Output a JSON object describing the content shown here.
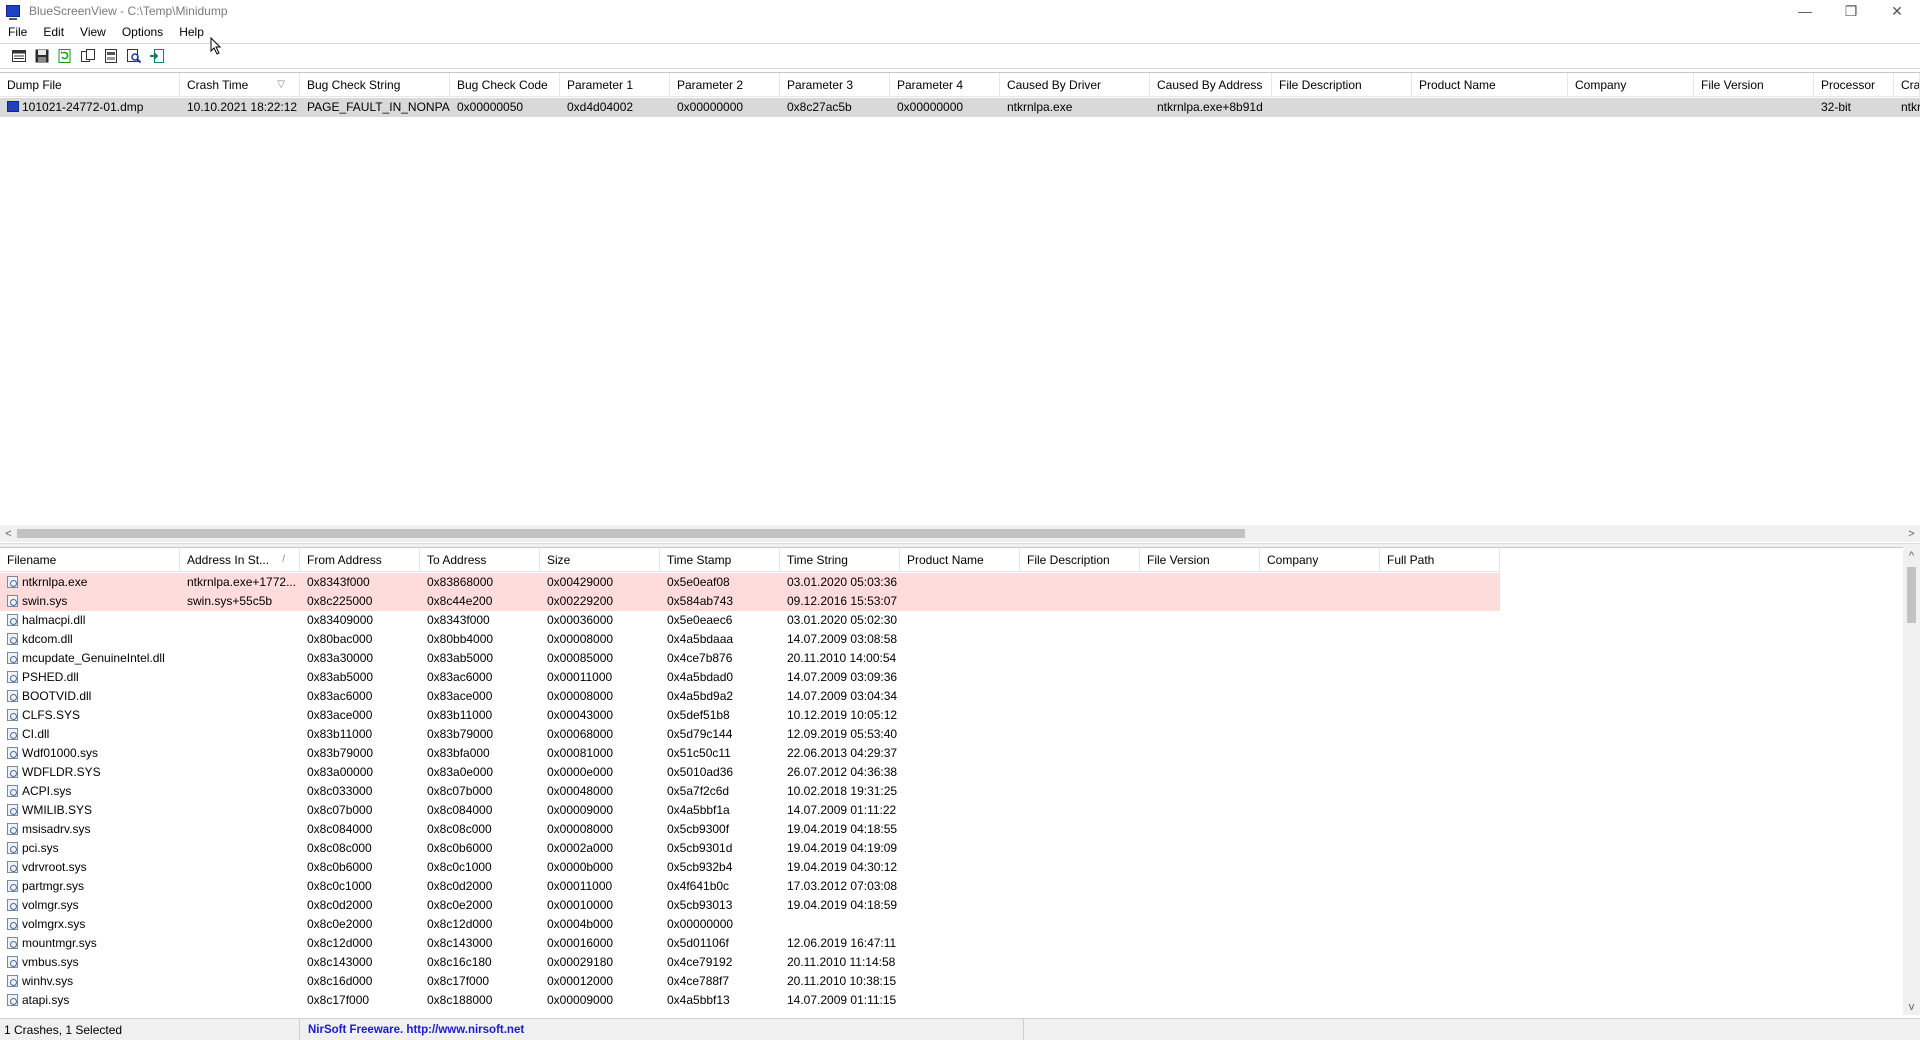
{
  "window": {
    "title": "BlueScreenView  -  C:\\Temp\\Minidump",
    "minimize": "—",
    "restore": "❐",
    "close": "✕"
  },
  "menu": [
    "File",
    "Edit",
    "View",
    "Options",
    "Help"
  ],
  "toolbar": {
    "buttons": [
      "properties-icon",
      "save-icon",
      "refresh-icon",
      "copy-icon",
      "html-report-icon",
      "find-icon",
      "exit-icon"
    ]
  },
  "crash_list": {
    "columns": [
      "Dump File",
      "Crash Time",
      "Bug Check String",
      "Bug Check Code",
      "Parameter 1",
      "Parameter 2",
      "Parameter 3",
      "Parameter 4",
      "Caused By Driver",
      "Caused By Address",
      "File Description",
      "Product Name",
      "Company",
      "File Version",
      "Processor",
      "Crash Add"
    ],
    "sort_indicator": "▽",
    "rows": [
      {
        "dump_file": "101021-24772-01.dmp",
        "crash_time": "10.10.2021 18:22:12",
        "bug_check_string": "PAGE_FAULT_IN_NONPA...",
        "bug_check_code": "0x00000050",
        "parameter_1": "0xd4d04002",
        "parameter_2": "0x00000000",
        "parameter_3": "0x8c27ac5b",
        "parameter_4": "0x00000000",
        "caused_by_driver": "ntkrnlpa.exe",
        "caused_by_address": "ntkrnlpa.exe+8b91d",
        "file_description": "",
        "product_name": "",
        "company": "",
        "file_version": "",
        "processor": "32-bit",
        "crash_address": "ntkrnlpa.e"
      }
    ]
  },
  "scroll": {
    "left_arrow": "<",
    "right_arrow": ">",
    "up_arrow": "^",
    "down_arrow": "v"
  },
  "module_list": {
    "columns": [
      "Filename",
      "Address In St...",
      "From Address",
      "To Address",
      "Size",
      "Time Stamp",
      "Time String",
      "Product Name",
      "File Description",
      "File Version",
      "Company",
      "Full Path"
    ],
    "sort_indicator": "/",
    "rows": [
      {
        "filename": "ntkrnlpa.exe",
        "address_in_stack": "ntkrnlpa.exe+1772...",
        "from": "0x8343f000",
        "to": "0x83868000",
        "size": "0x00429000",
        "stamp": "0x5e0eaf08",
        "time": "03.01.2020 05:03:36",
        "highlight": true
      },
      {
        "filename": "swin.sys",
        "address_in_stack": "swin.sys+55c5b",
        "from": "0x8c225000",
        "to": "0x8c44e200",
        "size": "0x00229200",
        "stamp": "0x584ab743",
        "time": "09.12.2016 15:53:07",
        "highlight": true
      },
      {
        "filename": "halmacpi.dll",
        "address_in_stack": "",
        "from": "0x83409000",
        "to": "0x8343f000",
        "size": "0x00036000",
        "stamp": "0x5e0eaec6",
        "time": "03.01.2020 05:02:30",
        "highlight": false
      },
      {
        "filename": "kdcom.dll",
        "address_in_stack": "",
        "from": "0x80bac000",
        "to": "0x80bb4000",
        "size": "0x00008000",
        "stamp": "0x4a5bdaaa",
        "time": "14.07.2009 03:08:58",
        "highlight": false
      },
      {
        "filename": "mcupdate_GenuineIntel.dll",
        "address_in_stack": "",
        "from": "0x83a30000",
        "to": "0x83ab5000",
        "size": "0x00085000",
        "stamp": "0x4ce7b876",
        "time": "20.11.2010 14:00:54",
        "highlight": false
      },
      {
        "filename": "PSHED.dll",
        "address_in_stack": "",
        "from": "0x83ab5000",
        "to": "0x83ac6000",
        "size": "0x00011000",
        "stamp": "0x4a5bdad0",
        "time": "14.07.2009 03:09:36",
        "highlight": false
      },
      {
        "filename": "BOOTVID.dll",
        "address_in_stack": "",
        "from": "0x83ac6000",
        "to": "0x83ace000",
        "size": "0x00008000",
        "stamp": "0x4a5bd9a2",
        "time": "14.07.2009 03:04:34",
        "highlight": false
      },
      {
        "filename": "CLFS.SYS",
        "address_in_stack": "",
        "from": "0x83ace000",
        "to": "0x83b11000",
        "size": "0x00043000",
        "stamp": "0x5def51b8",
        "time": "10.12.2019 10:05:12",
        "highlight": false
      },
      {
        "filename": "CI.dll",
        "address_in_stack": "",
        "from": "0x83b11000",
        "to": "0x83b79000",
        "size": "0x00068000",
        "stamp": "0x5d79c144",
        "time": "12.09.2019 05:53:40",
        "highlight": false
      },
      {
        "filename": "Wdf01000.sys",
        "address_in_stack": "",
        "from": "0x83b79000",
        "to": "0x83bfa000",
        "size": "0x00081000",
        "stamp": "0x51c50c11",
        "time": "22.06.2013 04:29:37",
        "highlight": false
      },
      {
        "filename": "WDFLDR.SYS",
        "address_in_stack": "",
        "from": "0x83a00000",
        "to": "0x83a0e000",
        "size": "0x0000e000",
        "stamp": "0x5010ad36",
        "time": "26.07.2012 04:36:38",
        "highlight": false
      },
      {
        "filename": "ACPI.sys",
        "address_in_stack": "",
        "from": "0x8c033000",
        "to": "0x8c07b000",
        "size": "0x00048000",
        "stamp": "0x5a7f2c6d",
        "time": "10.02.2018 19:31:25",
        "highlight": false
      },
      {
        "filename": "WMILIB.SYS",
        "address_in_stack": "",
        "from": "0x8c07b000",
        "to": "0x8c084000",
        "size": "0x00009000",
        "stamp": "0x4a5bbf1a",
        "time": "14.07.2009 01:11:22",
        "highlight": false
      },
      {
        "filename": "msisadrv.sys",
        "address_in_stack": "",
        "from": "0x8c084000",
        "to": "0x8c08c000",
        "size": "0x00008000",
        "stamp": "0x5cb9300f",
        "time": "19.04.2019 04:18:55",
        "highlight": false
      },
      {
        "filename": "pci.sys",
        "address_in_stack": "",
        "from": "0x8c08c000",
        "to": "0x8c0b6000",
        "size": "0x0002a000",
        "stamp": "0x5cb9301d",
        "time": "19.04.2019 04:19:09",
        "highlight": false
      },
      {
        "filename": "vdrvroot.sys",
        "address_in_stack": "",
        "from": "0x8c0b6000",
        "to": "0x8c0c1000",
        "size": "0x0000b000",
        "stamp": "0x5cb932b4",
        "time": "19.04.2019 04:30:12",
        "highlight": false
      },
      {
        "filename": "partmgr.sys",
        "address_in_stack": "",
        "from": "0x8c0c1000",
        "to": "0x8c0d2000",
        "size": "0x00011000",
        "stamp": "0x4f641b0c",
        "time": "17.03.2012 07:03:08",
        "highlight": false
      },
      {
        "filename": "volmgr.sys",
        "address_in_stack": "",
        "from": "0x8c0d2000",
        "to": "0x8c0e2000",
        "size": "0x00010000",
        "stamp": "0x5cb93013",
        "time": "19.04.2019 04:18:59",
        "highlight": false
      },
      {
        "filename": "volmgrx.sys",
        "address_in_stack": "",
        "from": "0x8c0e2000",
        "to": "0x8c12d000",
        "size": "0x0004b000",
        "stamp": "0x00000000",
        "time": "",
        "highlight": false
      },
      {
        "filename": "mountmgr.sys",
        "address_in_stack": "",
        "from": "0x8c12d000",
        "to": "0x8c143000",
        "size": "0x00016000",
        "stamp": "0x5d01106f",
        "time": "12.06.2019 16:47:11",
        "highlight": false
      },
      {
        "filename": "vmbus.sys",
        "address_in_stack": "",
        "from": "0x8c143000",
        "to": "0x8c16c180",
        "size": "0x00029180",
        "stamp": "0x4ce79192",
        "time": "20.11.2010 11:14:58",
        "highlight": false
      },
      {
        "filename": "winhv.sys",
        "address_in_stack": "",
        "from": "0x8c16d000",
        "to": "0x8c17f000",
        "size": "0x00012000",
        "stamp": "0x4ce788f7",
        "time": "20.11.2010 10:38:15",
        "highlight": false
      },
      {
        "filename": "atapi.sys",
        "address_in_stack": "",
        "from": "0x8c17f000",
        "to": "0x8c188000",
        "size": "0x00009000",
        "stamp": "0x4a5bbf13",
        "time": "14.07.2009 01:11:15",
        "highlight": false
      }
    ]
  },
  "status": {
    "count": "1 Crashes, 1 Selected",
    "credit": "NirSoft Freeware.  http://www.nirsoft.net"
  },
  "colors": {
    "highlight_row": "#ffdcdc",
    "selected_row": "#d9d9d9",
    "link": "#1a1ad0"
  }
}
